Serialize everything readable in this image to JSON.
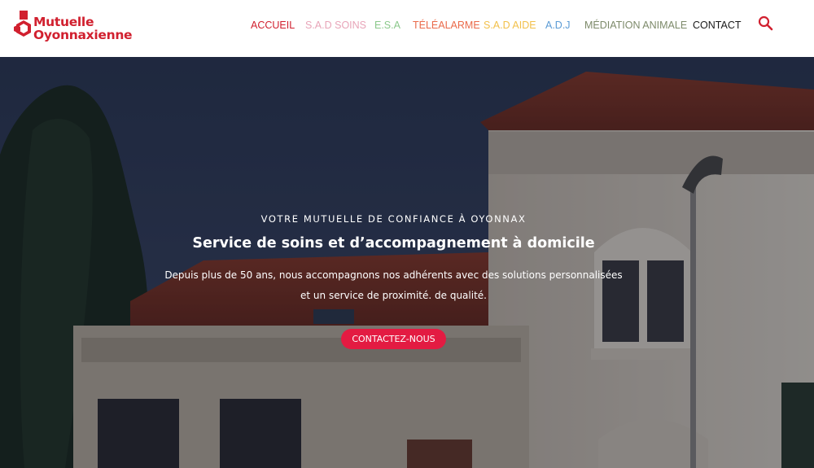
{
  "brand": {
    "name_line1": "Mutuelle",
    "name_line2": "Oyonnaxienne",
    "color": "#d1202f"
  },
  "nav": {
    "items": [
      {
        "label": "ACCUEIL",
        "color": "#d1202f"
      },
      {
        "label": "S.A.D SOINS",
        "color": "#e8a4b8"
      },
      {
        "label": "E.S.A",
        "color": "#8bc88b"
      },
      {
        "label": "TÉLÉALARME",
        "color": "#ea6a4a"
      },
      {
        "label": "S.A.D AIDE",
        "color": "#f2c04a"
      },
      {
        "label": "A.D.J",
        "color": "#5b9bd5"
      },
      {
        "label": "MÉDIATION ANIMALE",
        "color": "#7d8a6a"
      },
      {
        "label": "CONTACT",
        "color": "#1a1a1a"
      }
    ],
    "search_icon": "search-icon",
    "search_color": "#d1202f"
  },
  "hero": {
    "kicker": "VOTRE MUTUELLE DE CONFIANCE À OYONNAX",
    "title": "Service de soins et d’accompagnement à domicile",
    "desc_line1": "Depuis plus de 50 ans, nous accompagnons nos adhérents avec des solutions personnalisées",
    "desc_line2": "et un service de proximité. de qualité.",
    "cta": "CONTACTEZ-NOUS",
    "cta_color": "#e31b42",
    "sign_text": "Mutuelle"
  }
}
